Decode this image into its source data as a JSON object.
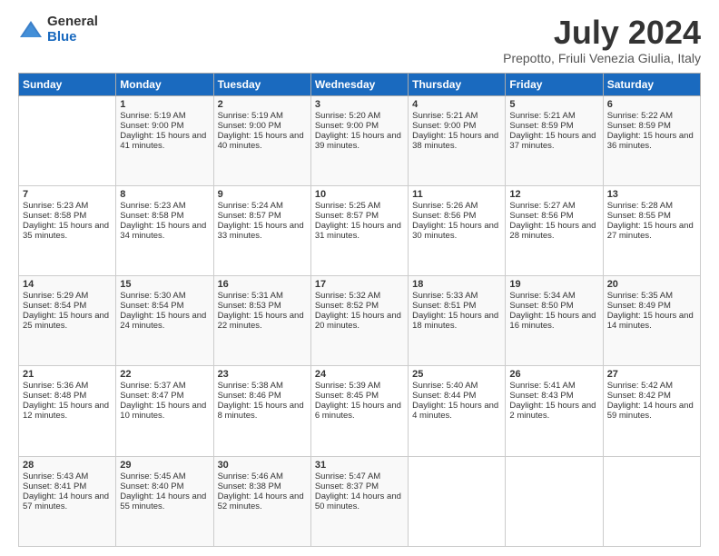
{
  "logo": {
    "general": "General",
    "blue": "Blue"
  },
  "title": "July 2024",
  "subtitle": "Prepotto, Friuli Venezia Giulia, Italy",
  "days_header": [
    "Sunday",
    "Monday",
    "Tuesday",
    "Wednesday",
    "Thursday",
    "Friday",
    "Saturday"
  ],
  "weeks": [
    [
      {
        "day": "",
        "sunrise": "",
        "sunset": "",
        "daylight": ""
      },
      {
        "day": "1",
        "sunrise": "Sunrise: 5:19 AM",
        "sunset": "Sunset: 9:00 PM",
        "daylight": "Daylight: 15 hours and 41 minutes."
      },
      {
        "day": "2",
        "sunrise": "Sunrise: 5:19 AM",
        "sunset": "Sunset: 9:00 PM",
        "daylight": "Daylight: 15 hours and 40 minutes."
      },
      {
        "day": "3",
        "sunrise": "Sunrise: 5:20 AM",
        "sunset": "Sunset: 9:00 PM",
        "daylight": "Daylight: 15 hours and 39 minutes."
      },
      {
        "day": "4",
        "sunrise": "Sunrise: 5:21 AM",
        "sunset": "Sunset: 9:00 PM",
        "daylight": "Daylight: 15 hours and 38 minutes."
      },
      {
        "day": "5",
        "sunrise": "Sunrise: 5:21 AM",
        "sunset": "Sunset: 8:59 PM",
        "daylight": "Daylight: 15 hours and 37 minutes."
      },
      {
        "day": "6",
        "sunrise": "Sunrise: 5:22 AM",
        "sunset": "Sunset: 8:59 PM",
        "daylight": "Daylight: 15 hours and 36 minutes."
      }
    ],
    [
      {
        "day": "7",
        "sunrise": "Sunrise: 5:23 AM",
        "sunset": "Sunset: 8:58 PM",
        "daylight": "Daylight: 15 hours and 35 minutes."
      },
      {
        "day": "8",
        "sunrise": "Sunrise: 5:23 AM",
        "sunset": "Sunset: 8:58 PM",
        "daylight": "Daylight: 15 hours and 34 minutes."
      },
      {
        "day": "9",
        "sunrise": "Sunrise: 5:24 AM",
        "sunset": "Sunset: 8:57 PM",
        "daylight": "Daylight: 15 hours and 33 minutes."
      },
      {
        "day": "10",
        "sunrise": "Sunrise: 5:25 AM",
        "sunset": "Sunset: 8:57 PM",
        "daylight": "Daylight: 15 hours and 31 minutes."
      },
      {
        "day": "11",
        "sunrise": "Sunrise: 5:26 AM",
        "sunset": "Sunset: 8:56 PM",
        "daylight": "Daylight: 15 hours and 30 minutes."
      },
      {
        "day": "12",
        "sunrise": "Sunrise: 5:27 AM",
        "sunset": "Sunset: 8:56 PM",
        "daylight": "Daylight: 15 hours and 28 minutes."
      },
      {
        "day": "13",
        "sunrise": "Sunrise: 5:28 AM",
        "sunset": "Sunset: 8:55 PM",
        "daylight": "Daylight: 15 hours and 27 minutes."
      }
    ],
    [
      {
        "day": "14",
        "sunrise": "Sunrise: 5:29 AM",
        "sunset": "Sunset: 8:54 PM",
        "daylight": "Daylight: 15 hours and 25 minutes."
      },
      {
        "day": "15",
        "sunrise": "Sunrise: 5:30 AM",
        "sunset": "Sunset: 8:54 PM",
        "daylight": "Daylight: 15 hours and 24 minutes."
      },
      {
        "day": "16",
        "sunrise": "Sunrise: 5:31 AM",
        "sunset": "Sunset: 8:53 PM",
        "daylight": "Daylight: 15 hours and 22 minutes."
      },
      {
        "day": "17",
        "sunrise": "Sunrise: 5:32 AM",
        "sunset": "Sunset: 8:52 PM",
        "daylight": "Daylight: 15 hours and 20 minutes."
      },
      {
        "day": "18",
        "sunrise": "Sunrise: 5:33 AM",
        "sunset": "Sunset: 8:51 PM",
        "daylight": "Daylight: 15 hours and 18 minutes."
      },
      {
        "day": "19",
        "sunrise": "Sunrise: 5:34 AM",
        "sunset": "Sunset: 8:50 PM",
        "daylight": "Daylight: 15 hours and 16 minutes."
      },
      {
        "day": "20",
        "sunrise": "Sunrise: 5:35 AM",
        "sunset": "Sunset: 8:49 PM",
        "daylight": "Daylight: 15 hours and 14 minutes."
      }
    ],
    [
      {
        "day": "21",
        "sunrise": "Sunrise: 5:36 AM",
        "sunset": "Sunset: 8:48 PM",
        "daylight": "Daylight: 15 hours and 12 minutes."
      },
      {
        "day": "22",
        "sunrise": "Sunrise: 5:37 AM",
        "sunset": "Sunset: 8:47 PM",
        "daylight": "Daylight: 15 hours and 10 minutes."
      },
      {
        "day": "23",
        "sunrise": "Sunrise: 5:38 AM",
        "sunset": "Sunset: 8:46 PM",
        "daylight": "Daylight: 15 hours and 8 minutes."
      },
      {
        "day": "24",
        "sunrise": "Sunrise: 5:39 AM",
        "sunset": "Sunset: 8:45 PM",
        "daylight": "Daylight: 15 hours and 6 minutes."
      },
      {
        "day": "25",
        "sunrise": "Sunrise: 5:40 AM",
        "sunset": "Sunset: 8:44 PM",
        "daylight": "Daylight: 15 hours and 4 minutes."
      },
      {
        "day": "26",
        "sunrise": "Sunrise: 5:41 AM",
        "sunset": "Sunset: 8:43 PM",
        "daylight": "Daylight: 15 hours and 2 minutes."
      },
      {
        "day": "27",
        "sunrise": "Sunrise: 5:42 AM",
        "sunset": "Sunset: 8:42 PM",
        "daylight": "Daylight: 14 hours and 59 minutes."
      }
    ],
    [
      {
        "day": "28",
        "sunrise": "Sunrise: 5:43 AM",
        "sunset": "Sunset: 8:41 PM",
        "daylight": "Daylight: 14 hours and 57 minutes."
      },
      {
        "day": "29",
        "sunrise": "Sunrise: 5:45 AM",
        "sunset": "Sunset: 8:40 PM",
        "daylight": "Daylight: 14 hours and 55 minutes."
      },
      {
        "day": "30",
        "sunrise": "Sunrise: 5:46 AM",
        "sunset": "Sunset: 8:38 PM",
        "daylight": "Daylight: 14 hours and 52 minutes."
      },
      {
        "day": "31",
        "sunrise": "Sunrise: 5:47 AM",
        "sunset": "Sunset: 8:37 PM",
        "daylight": "Daylight: 14 hours and 50 minutes."
      },
      {
        "day": "",
        "sunrise": "",
        "sunset": "",
        "daylight": ""
      },
      {
        "day": "",
        "sunrise": "",
        "sunset": "",
        "daylight": ""
      },
      {
        "day": "",
        "sunrise": "",
        "sunset": "",
        "daylight": ""
      }
    ]
  ]
}
